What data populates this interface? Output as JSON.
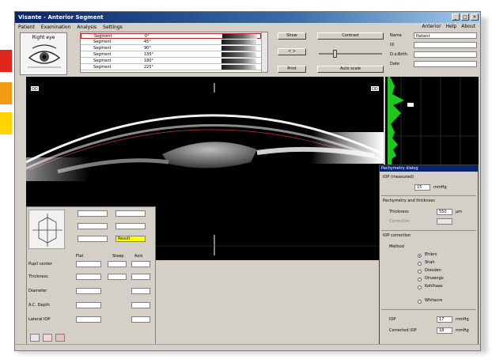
{
  "window": {
    "title": "Visante - Anterior Segment",
    "controls": {
      "minimize": "_",
      "maximize": "□",
      "close": "×"
    }
  },
  "menu": {
    "items": [
      "Patient",
      "Examination",
      "Analysis",
      "Settings"
    ],
    "right_items": [
      "Anterior",
      "Help",
      "About"
    ]
  },
  "eye_panel": {
    "label": "Right eye",
    "icon": "eye-icon"
  },
  "scan_list": {
    "rows": [
      {
        "id": "1",
        "label": "Segment",
        "angle": "0°"
      },
      {
        "id": "2",
        "label": "Segment",
        "angle": "45°"
      },
      {
        "id": "3",
        "label": "Segment",
        "angle": "90°"
      },
      {
        "id": "4",
        "label": "Segment",
        "angle": "135°"
      },
      {
        "id": "5",
        "label": "Segment",
        "angle": "180°"
      },
      {
        "id": "6",
        "label": "Segment",
        "angle": "225°"
      }
    ]
  },
  "buttons": {
    "b1": "Show",
    "b2": "< >",
    "b3": "Print",
    "b4": "Contrast",
    "b5": "Auto scale"
  },
  "patient": {
    "fields": [
      {
        "key": "Name",
        "value": "Patient"
      },
      {
        "key": "ID",
        "value": ""
      },
      {
        "key": "D.o.Birth",
        "value": ""
      },
      {
        "key": "Date",
        "value": ""
      }
    ]
  },
  "image": {
    "tag_left": "OD",
    "tag_right": "OD"
  },
  "measurement": {
    "col_headers": [
      "Flat",
      "Steep",
      "Axis"
    ],
    "rows": [
      {
        "label": "Pupil center",
        "v1": "",
        "v2": "",
        "v3": ""
      },
      {
        "label": "Thickness",
        "v1": "",
        "v2": "",
        "v3": ""
      },
      {
        "label": "Diameter",
        "v1": "",
        "v2": "",
        "v3": ""
      },
      {
        "label": "A.C. Depth",
        "v1": "",
        "v2": "",
        "v3": ""
      },
      {
        "label": "Lateral IOP",
        "v1": "",
        "v2": "",
        "v3": ""
      }
    ],
    "highlight_value": "Result"
  },
  "dialog": {
    "title": "Pachymetry dialog",
    "iop_label": "IOP (measured)",
    "iop_value": "15",
    "iop_unit": "mmHg",
    "section2": "Pachymetry and thickness",
    "thickness_label": "Thickness",
    "thickness_value": "550",
    "thickness_unit": "µm",
    "correction_label": "Correction",
    "section3": "IOP correction",
    "options_label": "Method",
    "options": [
      "Ehlers",
      "Shah",
      "Dresden",
      "Orssengo",
      "Kohlhaas",
      "Whitacre"
    ],
    "bottom_label_1": "IOP",
    "bottom_value_1": "17",
    "bottom_label_2": "Corrected IOP",
    "bottom_value_2": "18",
    "unit_mmhg": "mmHg"
  },
  "colors": {
    "titlebar": "#0a246a",
    "selection": "#b22222",
    "histogram": "#1ec81e",
    "highlight": "#ffff00",
    "dialog_title": "#0a246a"
  }
}
